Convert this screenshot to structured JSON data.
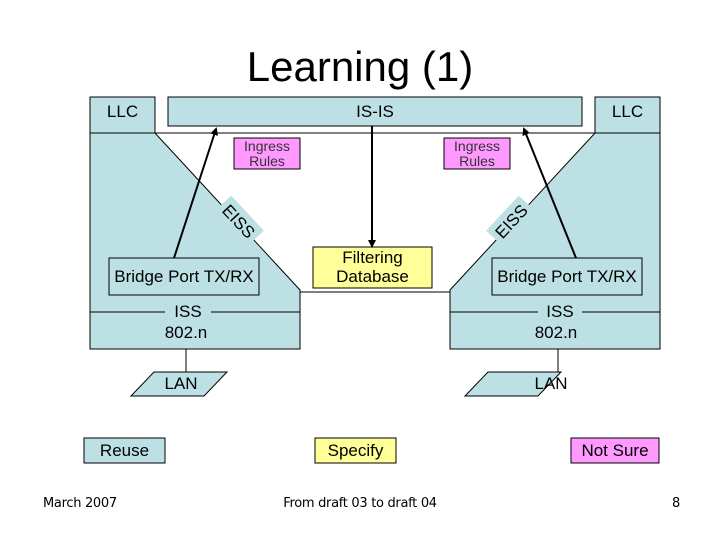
{
  "slide": {
    "title": "Learning (1)",
    "colors": {
      "reuse": "#bde0e4",
      "specify": "#ffff99",
      "not_sure": "#ff99ff",
      "outline": "#000000"
    }
  },
  "diagram": {
    "left_llc": "LLC",
    "right_llc": "LLC",
    "isis": "IS-IS",
    "ingress_left": [
      "Ingress",
      "Rules"
    ],
    "ingress_right": [
      "Ingress",
      "Rules"
    ],
    "eiss_left": "EISS",
    "eiss_right": "EISS",
    "bridge_port_left": "Bridge Port TX/RX",
    "bridge_port_right": "Bridge Port TX/RX",
    "filtering_db": [
      "Filtering",
      "Database"
    ],
    "iss_left": "ISS",
    "iss_right": "ISS",
    "mac_left": "802.n",
    "mac_right": "802.n",
    "lan_left": "LAN",
    "lan_right": "LAN"
  },
  "legend": {
    "reuse": "Reuse",
    "specify": "Specify",
    "not_sure": "Not Sure"
  },
  "footer": {
    "date": "March 2007",
    "center": "From draft 03 to draft 04",
    "page": "8"
  }
}
